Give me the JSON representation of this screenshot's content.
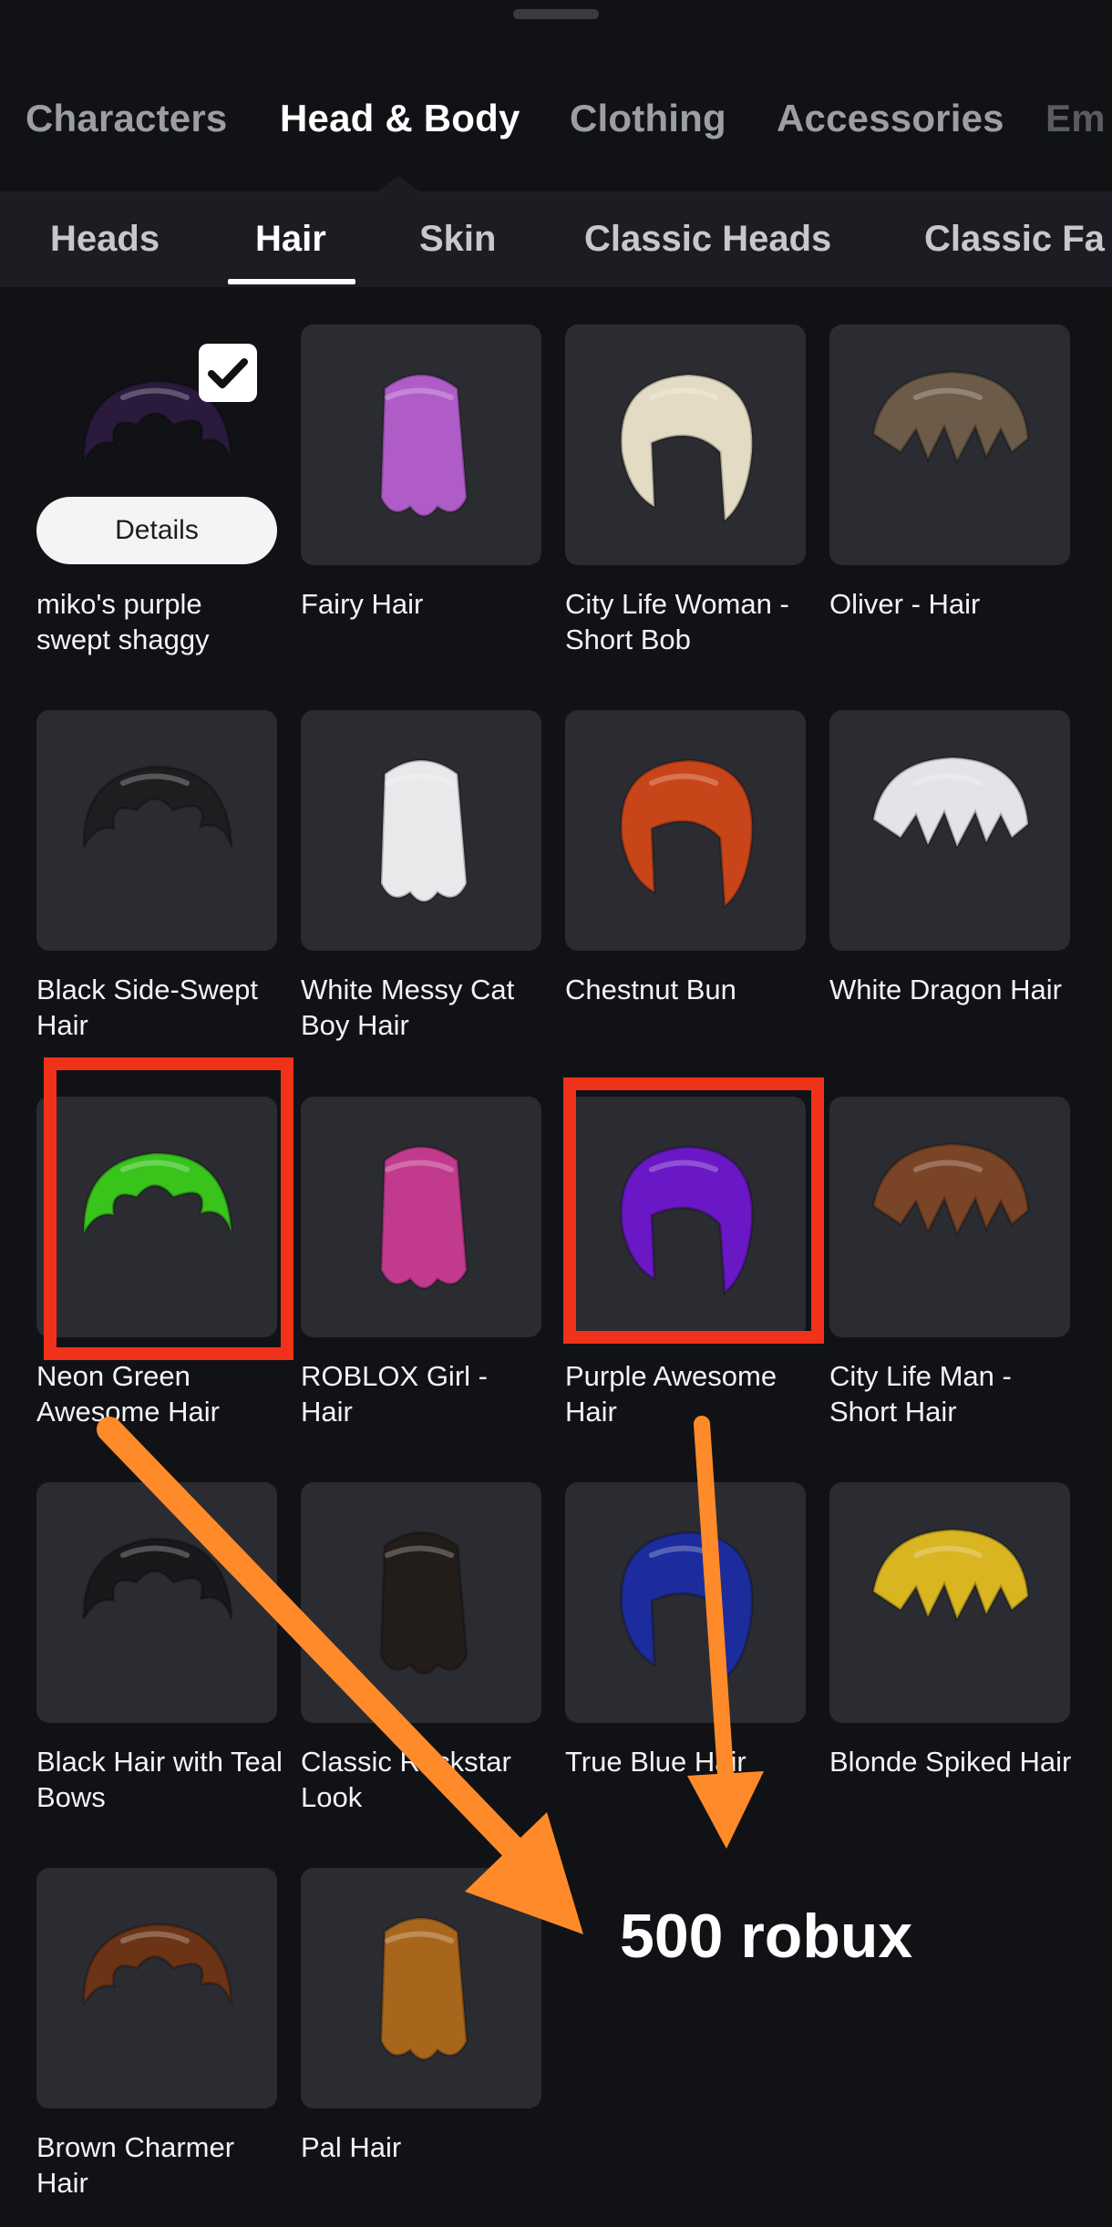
{
  "main_tabs": [
    {
      "label": "Characters"
    },
    {
      "label": "Head & Body"
    },
    {
      "label": "Clothing"
    },
    {
      "label": "Accessories"
    },
    {
      "label": "Em"
    }
  ],
  "sub_tabs": [
    {
      "label": "Heads"
    },
    {
      "label": "Hair"
    },
    {
      "label": "Skin"
    },
    {
      "label": "Classic Heads"
    },
    {
      "label": "Classic Fa"
    }
  ],
  "items": [
    {
      "name": "miko's purple swept shaggy",
      "color": "#2a1a3d"
    },
    {
      "name": "Fairy Hair",
      "color": "#b05cc8"
    },
    {
      "name": "City Life Woman - Short Bob",
      "color": "#e3dbc3"
    },
    {
      "name": "Oliver - Hair",
      "color": "#6b5b48"
    },
    {
      "name": "Black Side-Swept Hair",
      "color": "#1e1e20"
    },
    {
      "name": "White Messy Cat Boy Hair",
      "color": "#e9e9ec"
    },
    {
      "name": "Chestnut Bun",
      "color": "#c8451a"
    },
    {
      "name": "White Dragon Hair",
      "color": "#e4e4e8"
    },
    {
      "name": "Neon Green Awesome Hair",
      "color": "#39c41c"
    },
    {
      "name": "ROBLOX Girl - Hair",
      "color": "#c23a8e"
    },
    {
      "name": "Purple Awesome Hair",
      "color": "#6a17c6"
    },
    {
      "name": "City Life Man - Short Hair",
      "color": "#7a4426"
    },
    {
      "name": "Black Hair with Teal Bows",
      "color": "#18191b"
    },
    {
      "name": "Classic Rockstar Look",
      "color": "#231d1a"
    },
    {
      "name": "True Blue Hair",
      "color": "#1d2c9c"
    },
    {
      "name": "Blonde Spiked Hair",
      "color": "#d8b521"
    },
    {
      "name": "Brown Charmer Hair",
      "color": "#6b3416"
    },
    {
      "name": "Pal Hair",
      "color": "#a8661c"
    }
  ],
  "selected_item": {
    "details_label": "Details"
  },
  "annotation": {
    "price_text": "500 robux",
    "arrow_color": "#ff8a2a",
    "box_color": "#f0321a"
  }
}
